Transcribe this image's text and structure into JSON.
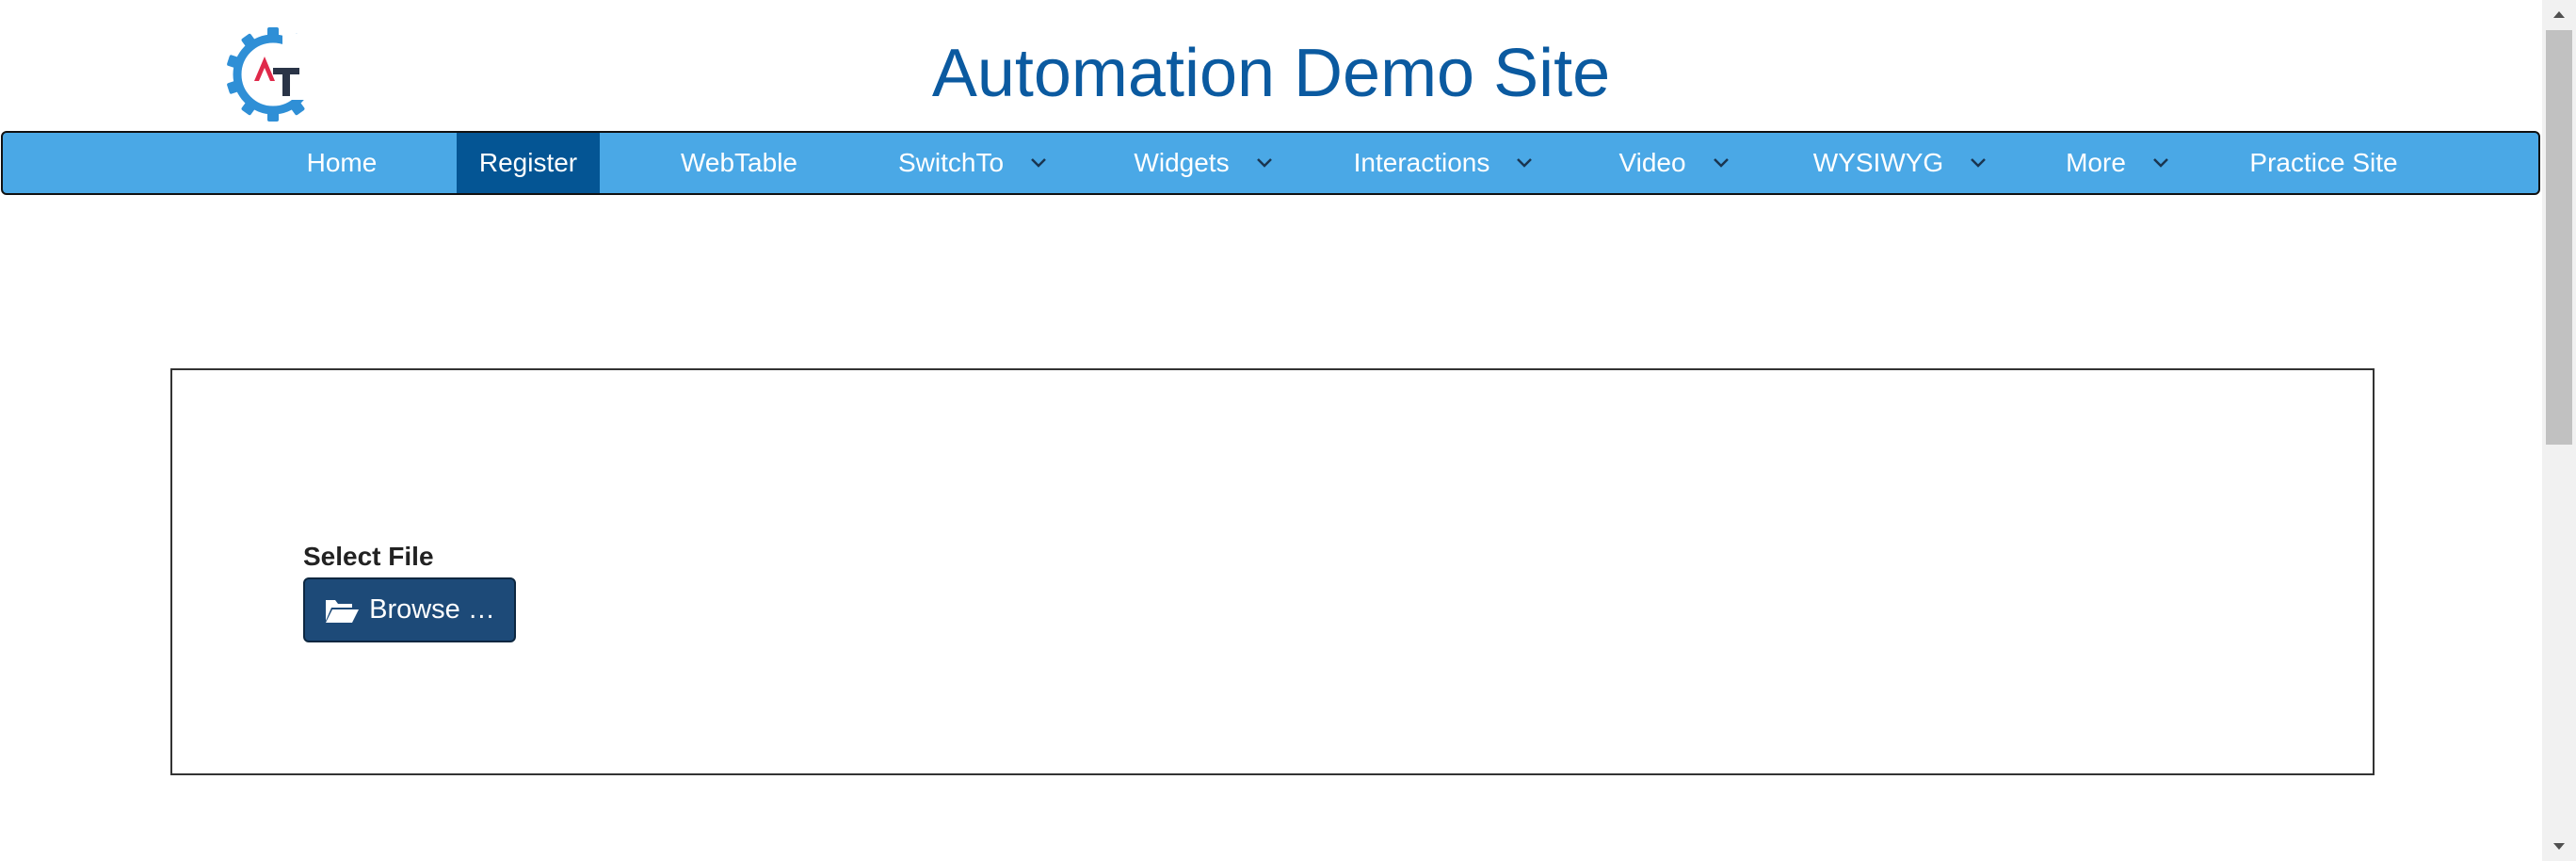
{
  "header": {
    "title": "Automation Demo Site",
    "logo_letters": "AT",
    "logo_colors": {
      "gear": "#2f8fd6",
      "accent": "#e0294a",
      "letter": "#2a3447"
    }
  },
  "nav": {
    "items": [
      {
        "label": "Home",
        "active": false,
        "dropdown": false
      },
      {
        "label": "Register",
        "active": true,
        "dropdown": false
      },
      {
        "label": "WebTable",
        "active": false,
        "dropdown": false
      },
      {
        "label": "SwitchTo",
        "active": false,
        "dropdown": true
      },
      {
        "label": "Widgets",
        "active": false,
        "dropdown": true
      },
      {
        "label": "Interactions",
        "active": false,
        "dropdown": true
      },
      {
        "label": "Video",
        "active": false,
        "dropdown": true
      },
      {
        "label": "WYSIWYG",
        "active": false,
        "dropdown": true
      },
      {
        "label": "More",
        "active": false,
        "dropdown": true
      },
      {
        "label": "Practice Site",
        "active": false,
        "dropdown": false
      }
    ],
    "colors": {
      "bar": "#4aa8e6",
      "active": "#045594",
      "text": "#ffffff"
    }
  },
  "upload": {
    "label": "Select File",
    "browse_label": "Browse …",
    "browse_icon": "folder-open-icon",
    "button_color": "#1d4a78"
  },
  "icons": {
    "dropdown": "chevron-down-icon",
    "scroll_up": "arrow-up-icon",
    "scroll_down": "arrow-down-icon"
  }
}
